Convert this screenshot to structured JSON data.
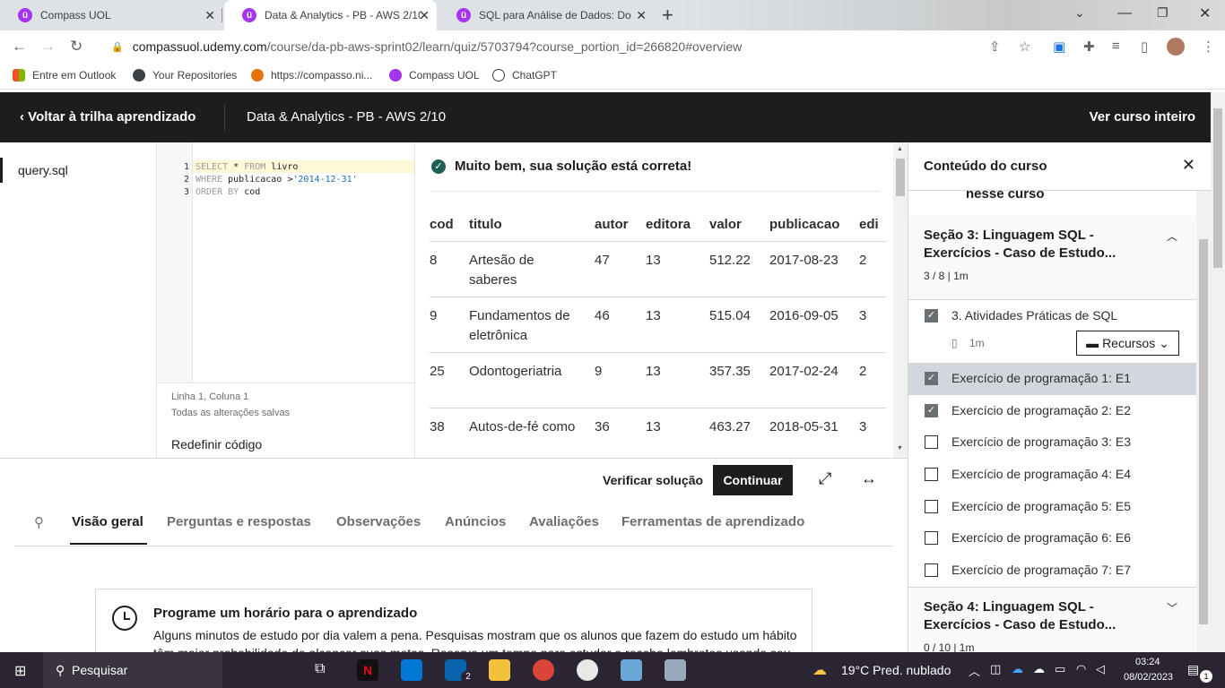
{
  "browser": {
    "tabs": [
      {
        "title": "Compass UOL",
        "active": false
      },
      {
        "title": "Data & Analytics - PB - AWS 2/10",
        "active": true
      },
      {
        "title": "SQL para Análise de Dados: Do",
        "active": false
      }
    ],
    "url_host": "compassuol.udemy.com",
    "url_path": "/course/da-pb-aws-sprint02/learn/quiz/5703794?course_portion_id=266820#overview",
    "bookmarks": [
      "Entre em Outlook",
      "Your Repositories",
      "https://compasso.ni...",
      "Compass UOL",
      "ChatGPT"
    ]
  },
  "header": {
    "back_label": "Voltar à trilha aprendizado",
    "course_title": "Data & Analytics - PB - AWS 2/10",
    "view_all_label": "Ver curso inteiro"
  },
  "files": {
    "active_file": "query.sql"
  },
  "editor": {
    "lines": [
      {
        "num": "1",
        "kw1": "SELECT",
        "mid1": " * ",
        "kw2": "FROM",
        "rest": " livro"
      },
      {
        "num": "2",
        "kw1": "WHERE",
        "mid1": " publicacao >",
        "str": "'2014-12-31'"
      },
      {
        "num": "3",
        "kw1": "ORDER BY",
        "mid1": " cod"
      }
    ],
    "cursor_status": "Linha 1, Coluna 1",
    "save_status": "Todas as alterações salvas",
    "reset_label": "Redefinir código"
  },
  "results": {
    "success_message": "Muito bem, sua solução está correta!",
    "columns": [
      "cod",
      "titulo",
      "autor",
      "editora",
      "valor",
      "publicacao",
      "edi"
    ],
    "rows": [
      [
        "8",
        "Artesão de saberes",
        "47",
        "13",
        "512.22",
        "2017-08-23",
        "2"
      ],
      [
        "9",
        "Fundamentos de eletrônica",
        "46",
        "13",
        "515.04",
        "2016-09-05",
        "3"
      ],
      [
        "25",
        "Odontogeriatria",
        "9",
        "13",
        "357.35",
        "2017-02-24",
        "2"
      ],
      [
        "38",
        "Autos-de-fé como",
        "36",
        "13",
        "463.27",
        "2018-05-31",
        "3"
      ]
    ]
  },
  "actions": {
    "verify_label": "Verificar solução",
    "continue_label": "Continuar"
  },
  "content_tabs": [
    "Visão geral",
    "Perguntas e respostas",
    "Observações",
    "Anúncios",
    "Avaliações",
    "Ferramentas de aprendizado"
  ],
  "reminder": {
    "title": "Programe um horário para o aprendizado",
    "text": "Alguns minutos de estudo por dia valem a pena. Pesquisas mostram que os alunos que fazem do estudo um hábito têm maior probabilidade de alcançar suas metas. Reserve um tempo para estudar e receba lembretes usando seu"
  },
  "sidebar": {
    "title": "Conteúdo do curso",
    "partial_text": "nesse curso",
    "section3": {
      "title": "Seção 3: Linguagem SQL - Exercícios - Caso de Estudo...",
      "meta": "3 / 8 | 1m"
    },
    "lecture": {
      "title": "3. Atividades Práticas de SQL",
      "duration": "1m",
      "resources_label": "Recursos"
    },
    "items": [
      {
        "label": "Exercício de programação 1: E1",
        "checked": true
      },
      {
        "label": "Exercício de programação 2: E2",
        "checked": true
      },
      {
        "label": "Exercício de programação 3: E3",
        "checked": false
      },
      {
        "label": "Exercício de programação 4: E4",
        "checked": false
      },
      {
        "label": "Exercício de programação 5: E5",
        "checked": false
      },
      {
        "label": "Exercício de programação 6: E6",
        "checked": false
      },
      {
        "label": "Exercício de programação 7: E7",
        "checked": false
      }
    ],
    "section4": {
      "title": "Seção 4: Linguagem SQL - Exercícios - Caso de Estudo...",
      "meta": "0 / 10 | 1m"
    }
  },
  "taskbar": {
    "search_placeholder": "Pesquisar",
    "weather": "19°C  Pred. nublado",
    "time": "03:24",
    "date": "08/02/2023",
    "mail_badge": "2",
    "notif_badge": "1"
  }
}
